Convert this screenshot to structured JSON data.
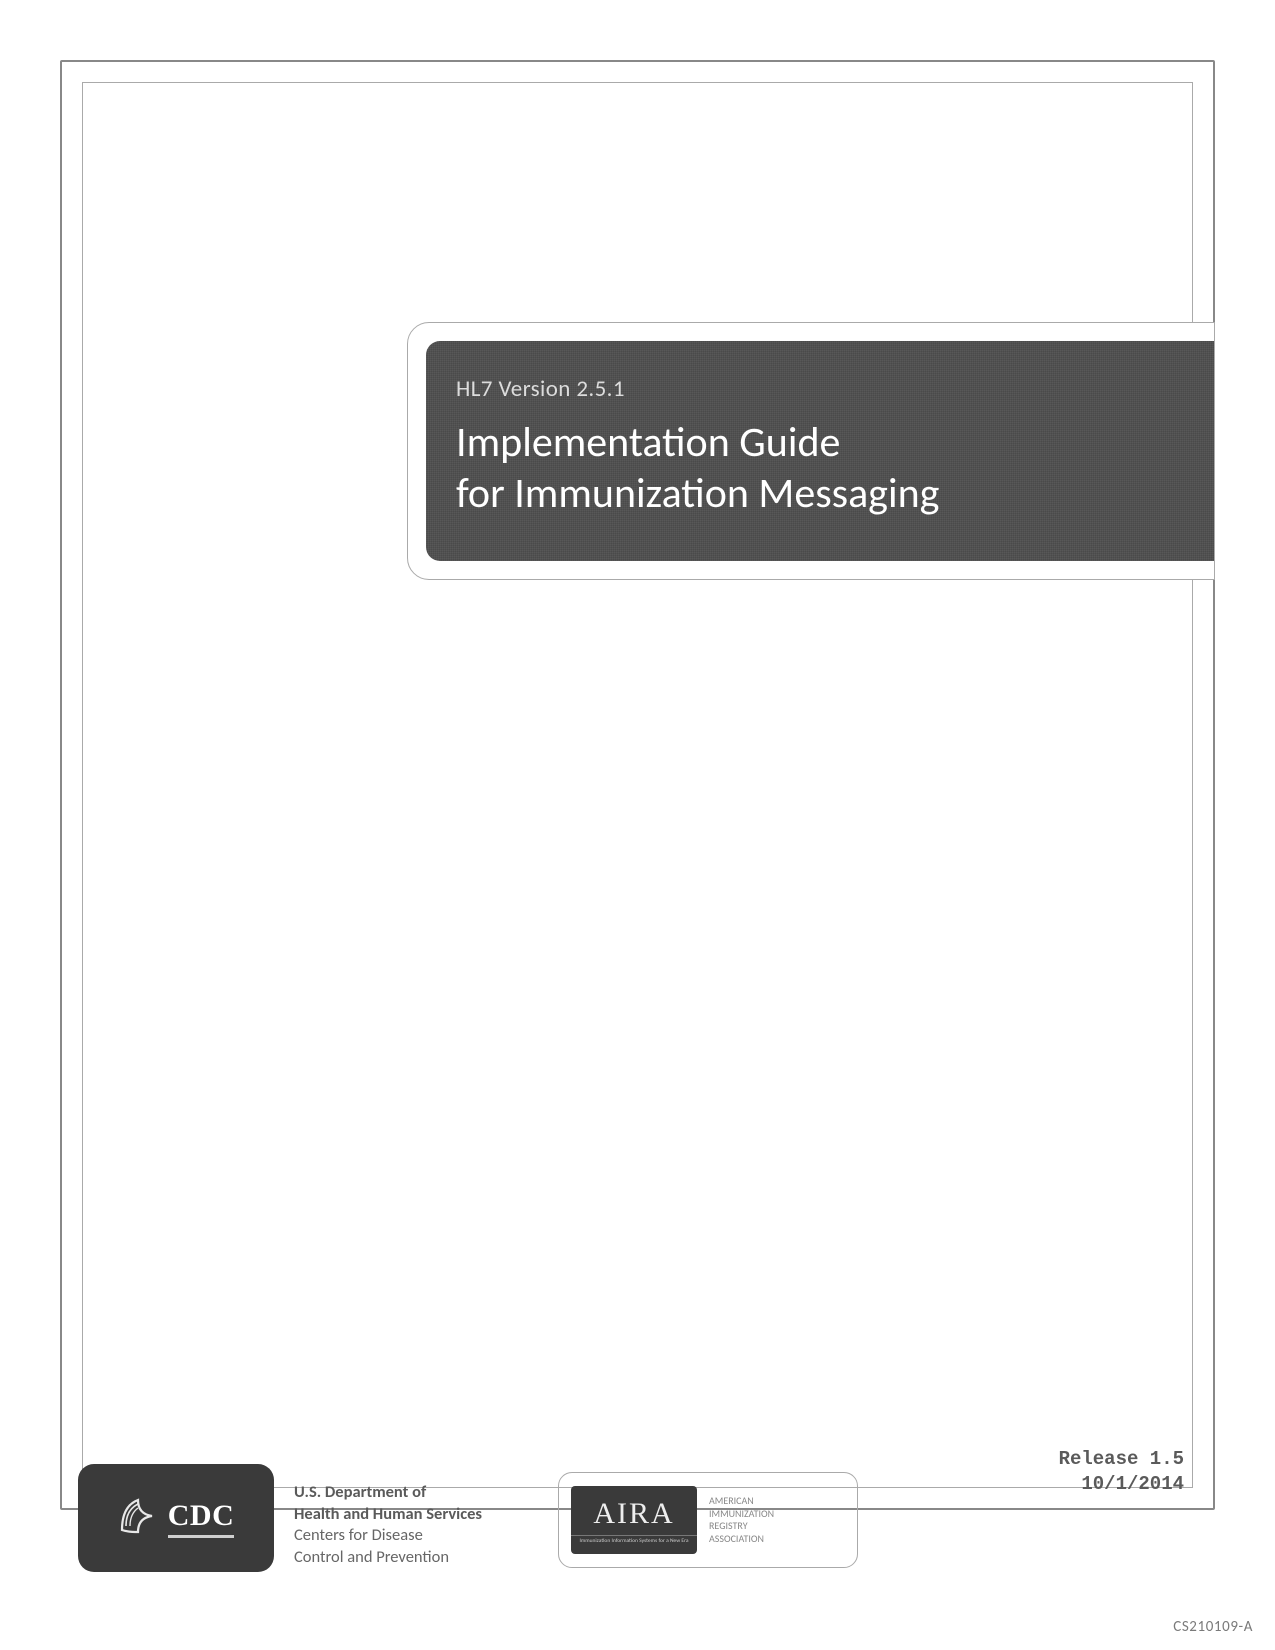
{
  "title": {
    "version_line": "HL7 Version 2.5.1",
    "main_line_1": "Implementation Guide",
    "main_line_2": "for Immunization Messaging"
  },
  "cdc": {
    "wordmark": "CDC",
    "dept_line": "U.S. Department of",
    "hhs_line": "Health and Human Services",
    "centers_line_1": "Centers for Disease",
    "centers_line_2": "Control and Prevention"
  },
  "aira": {
    "logo_main": "AIRA",
    "logo_sub": "Immunization Information Systems for a New Era",
    "text_line_1": "American",
    "text_line_2": "Immunization",
    "text_line_3": "Registry",
    "text_line_4": "Association"
  },
  "release": {
    "label": "Release 1.5",
    "date": "10/1/2014"
  },
  "docnum": "CS210109-A"
}
